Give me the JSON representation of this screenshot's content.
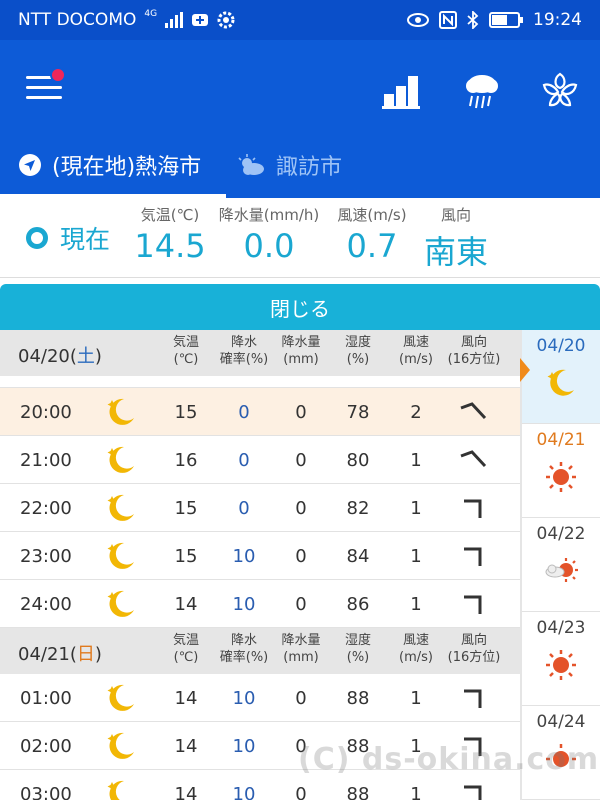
{
  "status": {
    "carrier": "NTT DOCOMO",
    "network": "4G",
    "time": "19:24"
  },
  "appbar": {
    "colors": {
      "primary": "#0d5bd7",
      "accent": "#1aa7d1",
      "badge": "#f0265a"
    }
  },
  "tabs": [
    {
      "label": "(現在地)熱海市",
      "icon": "location-arrow-icon"
    },
    {
      "label": "諏訪市",
      "icon": "partly-cloudy-icon"
    }
  ],
  "current": {
    "label": "現在",
    "columns": [
      {
        "header": "気温(℃)",
        "value": "14.5"
      },
      {
        "header": "降水量(mm/h)",
        "value": "0.0"
      },
      {
        "header": "風速(m/s)",
        "value": "0.7"
      },
      {
        "header": "風向",
        "value": "南東"
      }
    ]
  },
  "close_label": "閉じる",
  "headers": {
    "temp": [
      "気温",
      "(℃)"
    ],
    "prob": [
      "降水",
      "確率(%)"
    ],
    "precip": [
      "降水量",
      "(mm)"
    ],
    "humidity": [
      "湿度",
      "(%)"
    ],
    "wind": [
      "風速",
      "(m/s)"
    ],
    "dir": [
      "風向",
      "(16方位)"
    ]
  },
  "day1": {
    "date": "04/20",
    "dow": "土",
    "rows": [
      {
        "time": "20:00",
        "temp": "15",
        "prob": "0",
        "precip": "0",
        "humidity": "78",
        "wind": "2"
      },
      {
        "time": "21:00",
        "temp": "16",
        "prob": "0",
        "precip": "0",
        "humidity": "80",
        "wind": "1"
      },
      {
        "time": "22:00",
        "temp": "15",
        "prob": "0",
        "precip": "0",
        "humidity": "82",
        "wind": "1"
      },
      {
        "time": "23:00",
        "temp": "15",
        "prob": "10",
        "precip": "0",
        "humidity": "84",
        "wind": "1"
      },
      {
        "time": "24:00",
        "temp": "14",
        "prob": "10",
        "precip": "0",
        "humidity": "86",
        "wind": "1"
      }
    ]
  },
  "day2": {
    "date": "04/21",
    "dow": "日",
    "rows": [
      {
        "time": "01:00",
        "temp": "14",
        "prob": "10",
        "precip": "0",
        "humidity": "88",
        "wind": "1"
      },
      {
        "time": "02:00",
        "temp": "14",
        "prob": "10",
        "precip": "0",
        "humidity": "88",
        "wind": "1"
      },
      {
        "time": "03:00",
        "temp": "14",
        "prob": "10",
        "precip": "0",
        "humidity": "88",
        "wind": "1"
      }
    ]
  },
  "side": [
    {
      "date": "04/20",
      "icon": "moon-icon"
    },
    {
      "date": "04/21",
      "icon": "sun-icon"
    },
    {
      "date": "04/22",
      "icon": "cloud-sun-icon"
    },
    {
      "date": "04/23",
      "icon": "sun-icon"
    },
    {
      "date": "04/24",
      "icon": "sun-icon"
    }
  ],
  "watermark": "(C) ds-okina.com"
}
